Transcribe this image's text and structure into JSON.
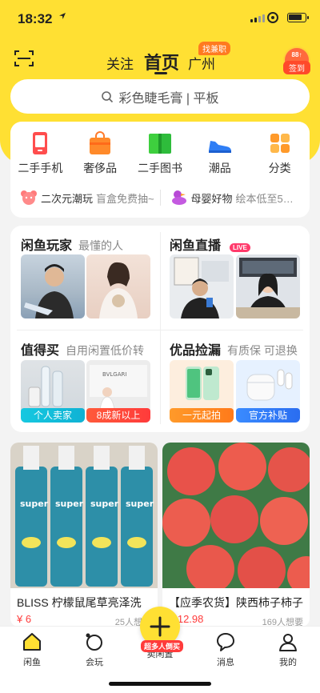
{
  "status_bar": {
    "time": "18:32"
  },
  "header": {
    "tabs": [
      "关注",
      "首页",
      "广州"
    ],
    "city_badge": "找兼职",
    "signin_top": "88↑",
    "signin_label": "签到"
  },
  "search": {
    "placeholder": "彩色睫毛膏 | 平板"
  },
  "categories": [
    {
      "label": "二手手机",
      "icon": "phone-icon"
    },
    {
      "label": "奢侈品",
      "icon": "bag-icon"
    },
    {
      "label": "二手图书",
      "icon": "book-icon"
    },
    {
      "label": "潮品",
      "icon": "sneaker-icon"
    },
    {
      "label": "分类",
      "icon": "grid-icon"
    }
  ],
  "promos": [
    {
      "title": "二次元潮玩",
      "sub": "盲盒免费抽~",
      "icon": "bear-icon"
    },
    {
      "title": "母婴好物",
      "sub": "绘本低至5…",
      "icon": "duck-icon"
    }
  ],
  "sections": {
    "players": {
      "title": "闲鱼玩家",
      "sub": "最懂的人"
    },
    "live": {
      "title": "闲鱼直播",
      "badge": "LIVE"
    },
    "worth": {
      "title": "值得买",
      "sub": "自用闲置低价转",
      "tags": [
        "个人卖家",
        "8成新以上"
      ]
    },
    "picks": {
      "title": "优品捡漏",
      "sub": "有质保 可退换",
      "tags": [
        "一元起拍",
        "官方补贴"
      ]
    }
  },
  "feed": [
    {
      "title": "BLISS 柠檬鼠尾草亮泽洗",
      "price": "¥ 6",
      "want": "25人想要"
    },
    {
      "title": "【应季农货】陕西柿子柿子",
      "price": "¥ 12.98",
      "want": "169人想要"
    }
  ],
  "tabbar": {
    "items": [
      "闲鱼",
      "会玩",
      "卖闲置",
      "消息",
      "我的"
    ],
    "sell_badge": "超多人倒买"
  },
  "colors": {
    "brand_yellow": "#ffe033",
    "accent_red": "#ff3b3b",
    "live_pink": "#ff3a6b"
  }
}
